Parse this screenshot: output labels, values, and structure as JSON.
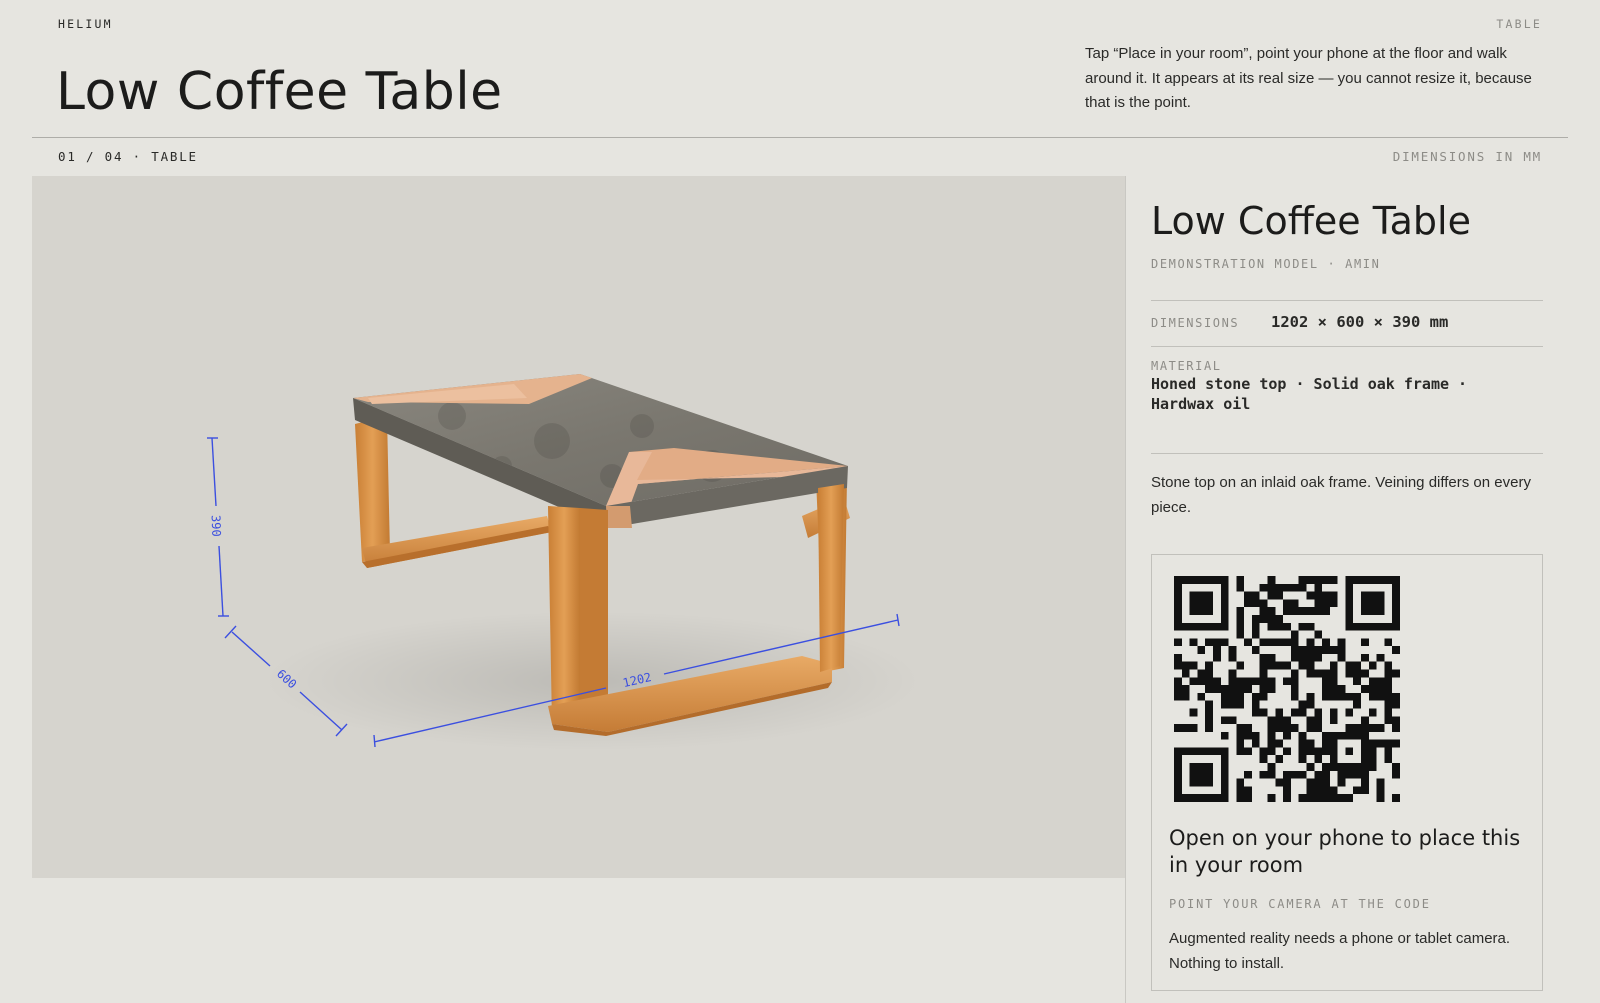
{
  "header": {
    "brand": "HELIUM",
    "category": "TABLE",
    "title": "Low Coffee Table",
    "intro": "Tap “Place in your room”, point your phone at the floor and walk around it. It appears at its real size — you cannot resize it, because that is the point."
  },
  "subbar": {
    "counter": "01 / 04 · TABLE",
    "units_note": "DIMENSIONS IN MM"
  },
  "viewer": {
    "dim_height": "390",
    "dim_depth": "600",
    "dim_width": "1202",
    "dimension_color": "#3b4fe0",
    "stone_color": "#7d7a73",
    "oak_color": "#d99449",
    "inlay_color": "#e6b593"
  },
  "panel": {
    "title": "Low Coffee Table",
    "subtitle": "DEMONSTRATION MODEL · AMIN",
    "dimensions_label": "DIMENSIONS",
    "dimensions_value": "1202 × 600 × 390 mm",
    "material_label": "MATERIAL",
    "material_value": "Honed stone top · Solid oak frame · Hardwax oil",
    "description": "Stone top on an inlaid oak frame. Veining differs on every piece."
  },
  "qr_card": {
    "title": "Open on your phone to place this in your room",
    "hint": "POINT YOUR CAMERA AT THE CODE",
    "note": "Augmented reality needs a phone or tablet camera. Nothing to install."
  }
}
